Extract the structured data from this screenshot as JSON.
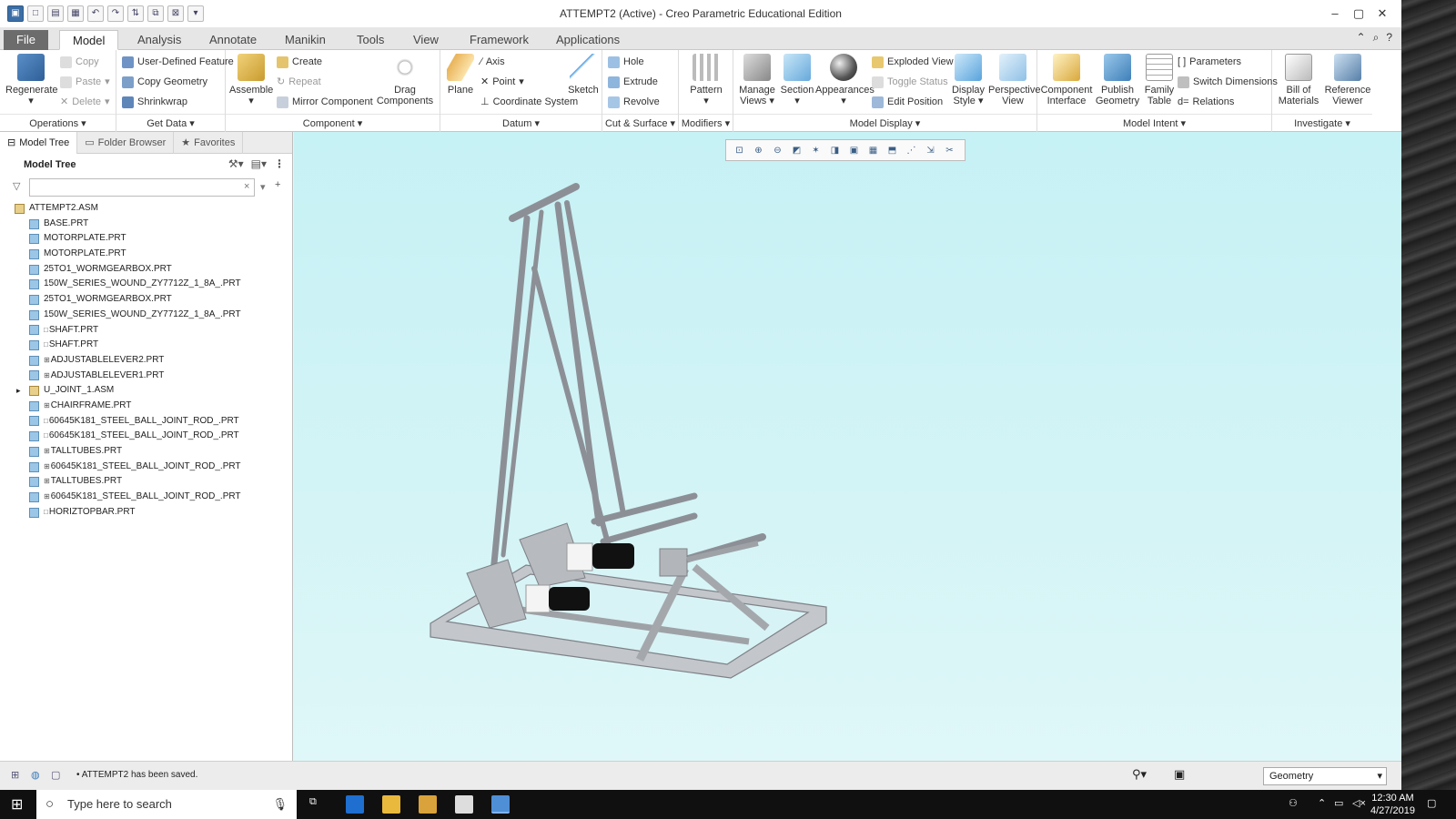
{
  "window": {
    "title": "ATTEMPT2 (Active) - Creo Parametric Educational Edition",
    "qat_icons": [
      "app-icon",
      "new-icon",
      "open-icon",
      "save-icon",
      "undo-icon",
      "redo-icon",
      "regenerate-icon",
      "windows-icon",
      "close-icon",
      "more-icon"
    ]
  },
  "tabs": [
    "File",
    "Model",
    "Analysis",
    "Annotate",
    "Manikin",
    "Tools",
    "View",
    "Framework",
    "Applications"
  ],
  "active_tab": "Model",
  "ribbon": {
    "operations": {
      "label": "Operations",
      "regenerate": "Regenerate",
      "copy": "Copy",
      "paste": "Paste",
      "delete": "Delete"
    },
    "getdata": {
      "label": "Get Data",
      "udf": "User-Defined Feature",
      "copy_geom": "Copy Geometry",
      "shrinkwrap": "Shrinkwrap"
    },
    "component": {
      "label": "Component",
      "assemble": "Assemble",
      "create": "Create",
      "repeat": "Repeat",
      "mirror": "Mirror Component",
      "drag": "Drag",
      "drag2": "Components"
    },
    "datum": {
      "label": "Datum",
      "plane": "Plane",
      "axis": "Axis",
      "point": "Point",
      "csys": "Coordinate System",
      "sketch": "Sketch"
    },
    "cut": {
      "label": "Cut & Surface",
      "hole": "Hole",
      "extrude": "Extrude",
      "revolve": "Revolve"
    },
    "modifiers": {
      "label": "Modifiers",
      "pattern": "Pattern"
    },
    "display": {
      "label": "Model Display",
      "manage": "Manage",
      "manage2": "Views",
      "section": "Section",
      "appearances": "Appearances",
      "exploded": "Exploded View",
      "toggle": "Toggle Status",
      "edit_pos": "Edit Position",
      "style": "Display",
      "style2": "Style",
      "persp": "Perspective",
      "persp2": "View"
    },
    "intent": {
      "label": "Model Intent",
      "comp_if": "Component",
      "comp_if2": "Interface",
      "publish": "Publish",
      "publish2": "Geometry",
      "family": "Family",
      "family2": "Table",
      "params": "Parameters",
      "switch_dims": "Switch Dimensions",
      "relations": "Relations"
    },
    "investigate": {
      "label": "Investigate",
      "bom": "Bill of",
      "bom2": "Materials",
      "ref": "Reference",
      "ref2": "Viewer"
    }
  },
  "panel": {
    "tabs": [
      "Model Tree",
      "Folder Browser",
      "Favorites"
    ],
    "header": "Model Tree",
    "filter_value": "",
    "tree": [
      {
        "name": "ATTEMPT2.ASM",
        "type": "asm",
        "indent": 0,
        "expand": false,
        "mark": ""
      },
      {
        "name": "BASE.PRT",
        "type": "prt",
        "indent": 1,
        "mark": ""
      },
      {
        "name": "MOTORPLATE.PRT",
        "type": "prt",
        "indent": 1,
        "mark": ""
      },
      {
        "name": "MOTORPLATE.PRT",
        "type": "prt",
        "indent": 1,
        "mark": ""
      },
      {
        "name": "25TO1_WORMGEARBOX.PRT",
        "type": "prt",
        "indent": 1,
        "mark": ""
      },
      {
        "name": "150W_SERIES_WOUND_ZY7712Z_1_8A_.PRT",
        "type": "prt",
        "indent": 1,
        "mark": ""
      },
      {
        "name": "25TO1_WORMGEARBOX.PRT",
        "type": "prt",
        "indent": 1,
        "mark": ""
      },
      {
        "name": "150W_SERIES_WOUND_ZY7712Z_1_8A_.PRT",
        "type": "prt",
        "indent": 1,
        "mark": ""
      },
      {
        "name": "SHAFT.PRT",
        "type": "prt",
        "indent": 1,
        "mark": "□"
      },
      {
        "name": "SHAFT.PRT",
        "type": "prt",
        "indent": 1,
        "mark": "□"
      },
      {
        "name": "ADJUSTABLELEVER2.PRT",
        "type": "prt",
        "indent": 1,
        "mark": "⊞"
      },
      {
        "name": "ADJUSTABLELEVER1.PRT",
        "type": "prt",
        "indent": 1,
        "mark": "⊞"
      },
      {
        "name": "U_JOINT_1.ASM",
        "type": "asm",
        "indent": 1,
        "expand": true,
        "mark": ""
      },
      {
        "name": "CHAIRFRAME.PRT",
        "type": "prt",
        "indent": 1,
        "mark": "⊞"
      },
      {
        "name": "60645K181_STEEL_BALL_JOINT_ROD_.PRT",
        "type": "prt",
        "indent": 1,
        "mark": "□"
      },
      {
        "name": "60645K181_STEEL_BALL_JOINT_ROD_.PRT",
        "type": "prt",
        "indent": 1,
        "mark": "□"
      },
      {
        "name": "TALLTUBES.PRT",
        "type": "prt",
        "indent": 1,
        "mark": "⊞"
      },
      {
        "name": "60645K181_STEEL_BALL_JOINT_ROD_.PRT",
        "type": "prt",
        "indent": 1,
        "mark": "⊞"
      },
      {
        "name": "TALLTUBES.PRT",
        "type": "prt",
        "indent": 1,
        "mark": "⊞"
      },
      {
        "name": "60645K181_STEEL_BALL_JOINT_ROD_.PRT",
        "type": "prt",
        "indent": 1,
        "mark": "⊞"
      },
      {
        "name": "HORIZTOPBAR.PRT",
        "type": "prt",
        "indent": 1,
        "mark": "□"
      }
    ]
  },
  "status": {
    "message": "ATTEMPT2 has been saved.",
    "selection_filter": "Geometry"
  },
  "taskbar": {
    "search_placeholder": "Type here to search",
    "time": "12:30 AM",
    "date": "4/27/2019"
  },
  "colors": {
    "viewport_bg": "#c6f1f5",
    "model_gray": "#a9acb0",
    "motor_black": "#111111",
    "file_tab": "#6c6c6c"
  }
}
